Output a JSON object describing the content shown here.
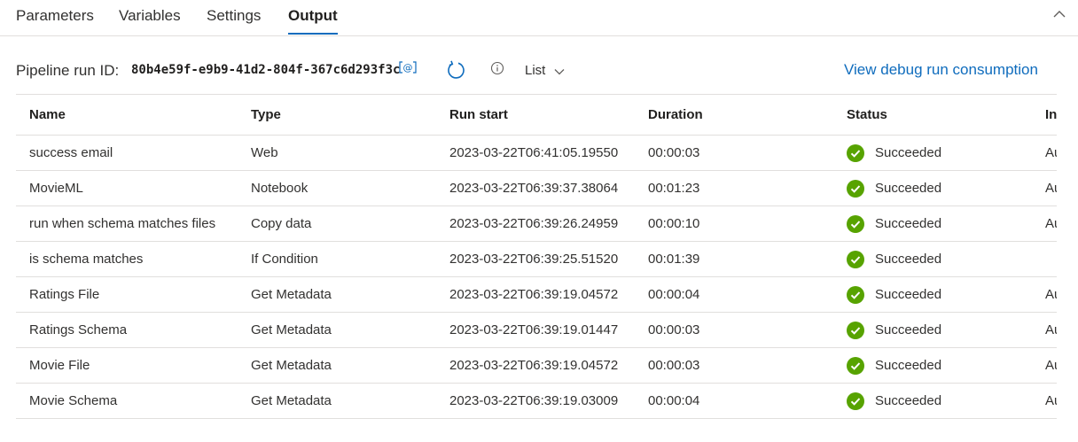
{
  "tabs": [
    {
      "label": "Parameters",
      "active": false
    },
    {
      "label": "Variables",
      "active": false
    },
    {
      "label": "Settings",
      "active": false
    },
    {
      "label": "Output",
      "active": true
    }
  ],
  "toolbar": {
    "run_id_label": "Pipeline run ID:",
    "run_id": "80b4e59f-e9b9-41d2-804f-367c6d293f3c",
    "view_selected": "List",
    "consumption_link": "View debug run consumption",
    "icons": [
      "copy-icon",
      "refresh-icon",
      "info-icon",
      "chevron-down-icon"
    ]
  },
  "table": {
    "headers": [
      "Name",
      "Type",
      "Run start",
      "Duration",
      "Status",
      "In"
    ],
    "rows": [
      {
        "name": "success email",
        "type": "Web",
        "run_start": "2023-03-22T06:41:05.19550",
        "duration": "00:00:03",
        "status": "Succeeded",
        "more": "Au"
      },
      {
        "name": "MovieML",
        "type": "Notebook",
        "run_start": "2023-03-22T06:39:37.38064",
        "duration": "00:01:23",
        "status": "Succeeded",
        "more": "Au"
      },
      {
        "name": "run when schema matches files",
        "type": "Copy data",
        "run_start": "2023-03-22T06:39:26.24959",
        "duration": "00:00:10",
        "status": "Succeeded",
        "more": "Au"
      },
      {
        "name": "is schema matches",
        "type": "If Condition",
        "run_start": "2023-03-22T06:39:25.51520",
        "duration": "00:01:39",
        "status": "Succeeded",
        "more": ""
      },
      {
        "name": "Ratings File",
        "type": "Get Metadata",
        "run_start": "2023-03-22T06:39:19.04572",
        "duration": "00:00:04",
        "status": "Succeeded",
        "more": "Au"
      },
      {
        "name": "Ratings Schema",
        "type": "Get Metadata",
        "run_start": "2023-03-22T06:39:19.01447",
        "duration": "00:00:03",
        "status": "Succeeded",
        "more": "Au"
      },
      {
        "name": "Movie File",
        "type": "Get Metadata",
        "run_start": "2023-03-22T06:39:19.04572",
        "duration": "00:00:03",
        "status": "Succeeded",
        "more": "Au"
      },
      {
        "name": "Movie Schema",
        "type": "Get Metadata",
        "run_start": "2023-03-22T06:39:19.03009",
        "duration": "00:00:04",
        "status": "Succeeded",
        "more": "Au"
      }
    ]
  },
  "colors": {
    "accent": "#0f6cbd",
    "success": "#57a300",
    "border": "#e1dfdd"
  }
}
